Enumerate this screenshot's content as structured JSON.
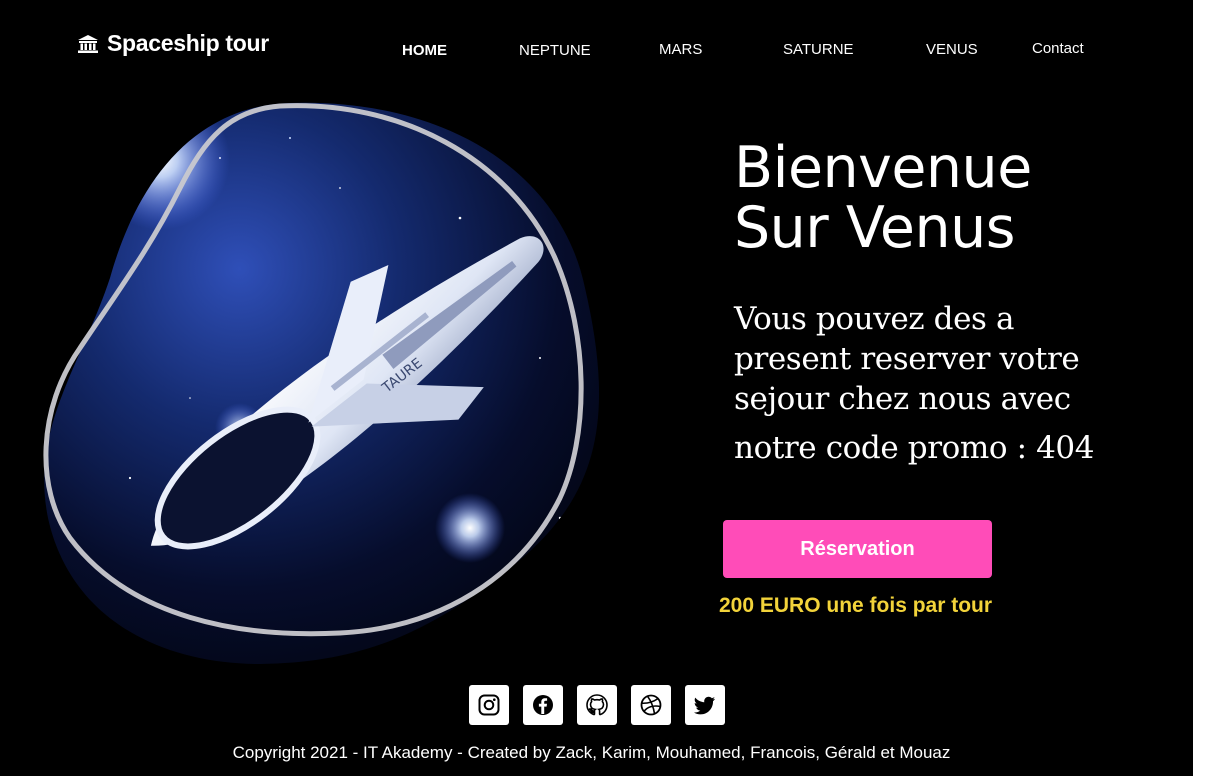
{
  "header": {
    "logo_icon": "bank-icon",
    "logo_text": "Spaceship tour"
  },
  "nav": {
    "items": [
      {
        "label": "HOME",
        "active": true
      },
      {
        "label": "NEPTUNE"
      },
      {
        "label": "MARS"
      },
      {
        "label": "SATURNE"
      },
      {
        "label": "VENUS"
      },
      {
        "label": "Contact"
      }
    ]
  },
  "hero": {
    "image_alt": "spaceship-image",
    "title_line1": "Bienvenue",
    "title_line2": "Sur Venus",
    "text": "Vous pouvez des a present reserver votre sejour chez nous avec",
    "promo": "notre code promo : 404",
    "button_label": "Réservation",
    "price_note": "200 EURO une fois par tour",
    "accent_color": "#ff4cb8",
    "price_color": "#f2d33a"
  },
  "social": {
    "icons": [
      "instagram-icon",
      "facebook-icon",
      "github-icon",
      "dribbble-icon",
      "twitter-icon"
    ]
  },
  "footer": {
    "copyright": "Copyright 2021 - IT Akademy - Created by Zack, Karim, Mouhamed, Francois, Gérald et Mouaz"
  }
}
